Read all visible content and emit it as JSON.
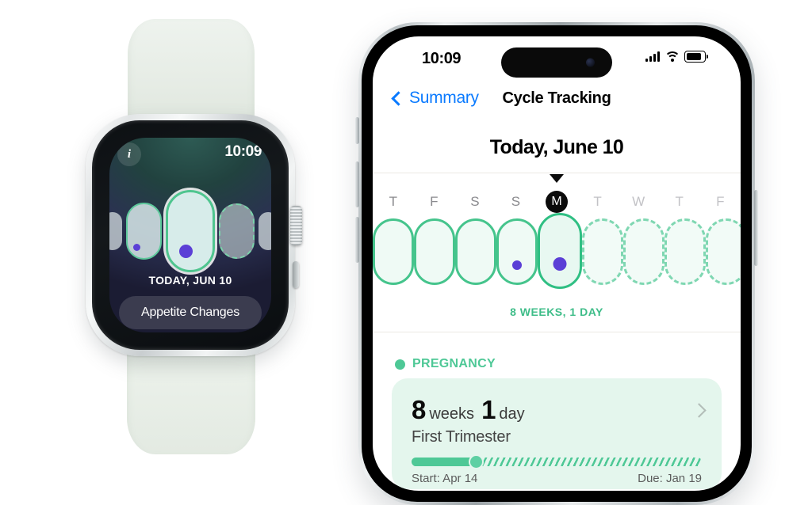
{
  "watch": {
    "info_icon": "info-icon",
    "time": "10:09",
    "date_label": "TODAY, JUN 10",
    "action_button": "Appetite Changes",
    "timeline": [
      {
        "kind": "tiny",
        "dot": "none"
      },
      {
        "kind": "small",
        "dot": "none"
      },
      {
        "kind": "med",
        "dot": "small"
      },
      {
        "kind": "big",
        "dot": "large"
      },
      {
        "kind": "dash",
        "dot": "none"
      },
      {
        "kind": "small",
        "dot": "none"
      },
      {
        "kind": "tiny",
        "dot": "none"
      }
    ]
  },
  "phone": {
    "status": {
      "time": "10:09",
      "cellular_icon": "cellular-bars-icon",
      "wifi_icon": "wifi-icon",
      "battery_icon": "battery-icon"
    },
    "nav": {
      "back_icon": "chevron-left-icon",
      "back_label": "Summary",
      "title": "Cycle Tracking"
    },
    "today_title": "Today, June 10",
    "days": [
      {
        "letter": "T",
        "state": "past",
        "partial": true
      },
      {
        "letter": "F",
        "state": "past",
        "partial": false
      },
      {
        "letter": "S",
        "state": "past",
        "partial": false
      },
      {
        "letter": "S",
        "state": "past",
        "partial": false
      },
      {
        "letter": "M",
        "state": "today",
        "partial": false
      },
      {
        "letter": "T",
        "state": "future",
        "partial": false
      },
      {
        "letter": "W",
        "state": "future",
        "partial": false
      },
      {
        "letter": "T",
        "state": "future",
        "partial": false
      },
      {
        "letter": "F",
        "state": "future",
        "partial": true
      }
    ],
    "day_pills": [
      {
        "style": "solid",
        "dot": "none",
        "active": false
      },
      {
        "style": "solid",
        "dot": "none",
        "active": false
      },
      {
        "style": "solid",
        "dot": "none",
        "active": false
      },
      {
        "style": "solid",
        "dot": "small",
        "active": false
      },
      {
        "style": "solid",
        "dot": "large",
        "active": true
      },
      {
        "style": "dashed",
        "dot": "none",
        "active": false
      },
      {
        "style": "dashed",
        "dot": "none",
        "active": false
      },
      {
        "style": "dashed",
        "dot": "none",
        "active": false
      },
      {
        "style": "dashed",
        "dot": "none",
        "active": false
      }
    ],
    "weeks_label": "8 WEEKS, 1 DAY",
    "section": {
      "status_dot": "status-dot-green",
      "title": "PREGNANCY"
    },
    "card": {
      "weeks_value": "8",
      "weeks_unit": "weeks",
      "days_value": "1",
      "days_unit": "day",
      "trimester": "First Trimester",
      "progress_percent": 22,
      "start_label": "Start: Apr 14",
      "due_label": "Due: Jan 19",
      "chevron_icon": "chevron-right-icon"
    }
  },
  "colors": {
    "accent_green": "#4ec896",
    "link_blue": "#0a7aff",
    "symptom_purple": "#5b3fd6",
    "card_bg": "#e4f6ed"
  }
}
